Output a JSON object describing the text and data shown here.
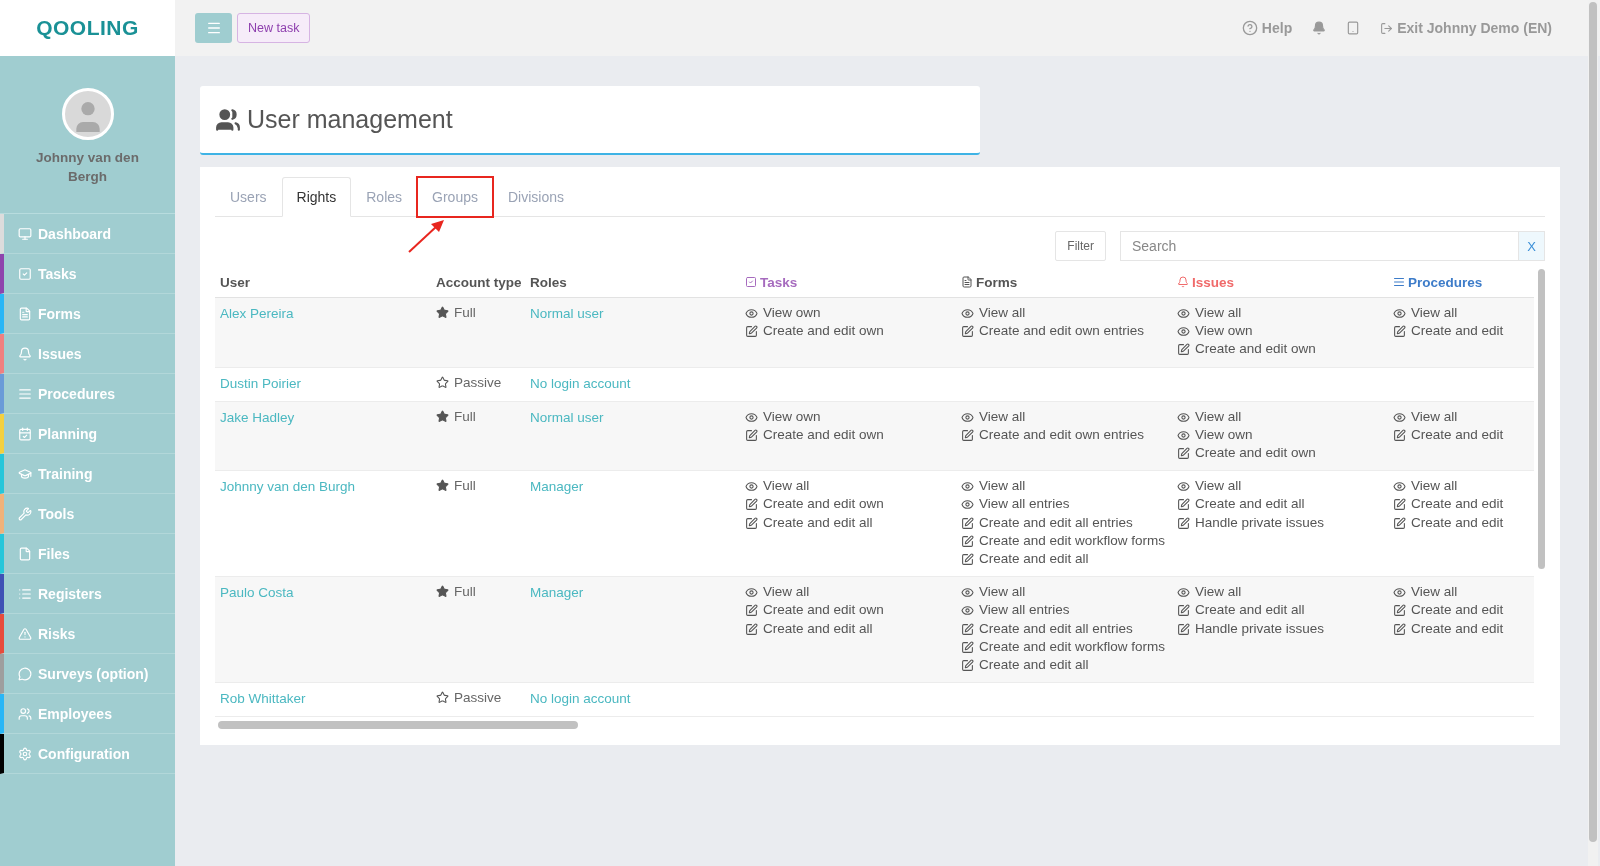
{
  "logo": "QOOLING",
  "topbar": {
    "new_task": "New task",
    "help": "Help",
    "exit": "Exit Johnny Demo (EN)"
  },
  "user": {
    "name": "Johnny van den Bergh"
  },
  "sidebar": {
    "items": [
      {
        "label": "Dashboard",
        "color": "#dcdcdc"
      },
      {
        "label": "Tasks",
        "color": "#8e44ad"
      },
      {
        "label": "Forms",
        "color": "#29b6f6"
      },
      {
        "label": "Issues",
        "color": "#f08080"
      },
      {
        "label": "Procedures",
        "color": "#6a9bd8"
      },
      {
        "label": "Planning",
        "color": "#f4d03f"
      },
      {
        "label": "Training",
        "color": "#26c6da"
      },
      {
        "label": "Tools",
        "color": "#f0b27a"
      },
      {
        "label": "Files",
        "color": "#26c6da"
      },
      {
        "label": "Registers",
        "color": "#3f51b5"
      },
      {
        "label": "Risks",
        "color": "#e74c3c"
      },
      {
        "label": "Surveys (option)",
        "color": "#9e9e9e"
      },
      {
        "label": "Employees",
        "color": "#29b6f6"
      },
      {
        "label": "Configuration",
        "color": "#000000"
      }
    ]
  },
  "page_title": "User management",
  "tabs": [
    {
      "label": "Users",
      "selected": false,
      "highlighted": false
    },
    {
      "label": "Rights",
      "selected": true,
      "highlighted": false
    },
    {
      "label": "Roles",
      "selected": false,
      "highlighted": false
    },
    {
      "label": "Groups",
      "selected": false,
      "highlighted": true
    },
    {
      "label": "Divisions",
      "selected": false,
      "highlighted": false
    }
  ],
  "filter_button": "Filter",
  "search": {
    "placeholder": "Search",
    "clear": "X"
  },
  "table": {
    "columns": [
      {
        "label": "User"
      },
      {
        "label": "Account type"
      },
      {
        "label": "Roles"
      },
      {
        "label": "Tasks",
        "color": "#a66bbe"
      },
      {
        "label": "Forms",
        "color": "#555555"
      },
      {
        "label": "Issues",
        "color": "#f06a6a"
      },
      {
        "label": "Procedures",
        "color": "#3d7cc9"
      }
    ],
    "rows": [
      {
        "user": "Alex Pereira",
        "account": {
          "kind": "full",
          "label": "Full"
        },
        "role": "Normal user",
        "tasks": [
          {
            "kind": "view",
            "label": "View own"
          },
          {
            "kind": "edit",
            "label": "Create and edit own"
          }
        ],
        "forms": [
          {
            "kind": "view",
            "label": "View all"
          },
          {
            "kind": "edit",
            "label": "Create and edit own entries"
          }
        ],
        "issues": [
          {
            "kind": "view",
            "label": "View all"
          },
          {
            "kind": "view",
            "label": "View own"
          },
          {
            "kind": "edit",
            "label": "Create and edit own"
          }
        ],
        "procedures": [
          {
            "kind": "view",
            "label": "View all"
          },
          {
            "kind": "edit",
            "label": "Create and edit"
          }
        ]
      },
      {
        "user": "Dustin Poirier",
        "account": {
          "kind": "passive",
          "label": "Passive"
        },
        "role": "No login account"
      },
      {
        "user": "Jake Hadley",
        "account": {
          "kind": "full",
          "label": "Full"
        },
        "role": "Normal user",
        "tasks": [
          {
            "kind": "view",
            "label": "View own"
          },
          {
            "kind": "edit",
            "label": "Create and edit own"
          }
        ],
        "forms": [
          {
            "kind": "view",
            "label": "View all"
          },
          {
            "kind": "edit",
            "label": "Create and edit own entries"
          }
        ],
        "issues": [
          {
            "kind": "view",
            "label": "View all"
          },
          {
            "kind": "view",
            "label": "View own"
          },
          {
            "kind": "edit",
            "label": "Create and edit own"
          }
        ],
        "procedures": [
          {
            "kind": "view",
            "label": "View all"
          },
          {
            "kind": "edit",
            "label": "Create and edit"
          }
        ]
      },
      {
        "user": "Johnny van den Burgh",
        "account": {
          "kind": "full",
          "label": "Full"
        },
        "role": "Manager",
        "tasks": [
          {
            "kind": "view",
            "label": "View all"
          },
          {
            "kind": "edit",
            "label": "Create and edit own"
          },
          {
            "kind": "edit",
            "label": "Create and edit all"
          }
        ],
        "forms": [
          {
            "kind": "view",
            "label": "View all"
          },
          {
            "kind": "view",
            "label": "View all entries"
          },
          {
            "kind": "edit",
            "label": "Create and edit all entries"
          },
          {
            "kind": "edit",
            "label": "Create and edit workflow forms"
          },
          {
            "kind": "edit",
            "label": "Create and edit all"
          }
        ],
        "issues": [
          {
            "kind": "view",
            "label": "View all"
          },
          {
            "kind": "edit",
            "label": "Create and edit all"
          },
          {
            "kind": "edit",
            "label": "Handle private issues"
          }
        ],
        "procedures": [
          {
            "kind": "view",
            "label": "View all"
          },
          {
            "kind": "edit",
            "label": "Create and edit"
          },
          {
            "kind": "edit",
            "label": "Create and edit"
          }
        ]
      },
      {
        "user": "Paulo Costa",
        "account": {
          "kind": "full",
          "label": "Full"
        },
        "role": "Manager",
        "tasks": [
          {
            "kind": "view",
            "label": "View all"
          },
          {
            "kind": "edit",
            "label": "Create and edit own"
          },
          {
            "kind": "edit",
            "label": "Create and edit all"
          }
        ],
        "forms": [
          {
            "kind": "view",
            "label": "View all"
          },
          {
            "kind": "view",
            "label": "View all entries"
          },
          {
            "kind": "edit",
            "label": "Create and edit all entries"
          },
          {
            "kind": "edit",
            "label": "Create and edit workflow forms"
          },
          {
            "kind": "edit",
            "label": "Create and edit all"
          }
        ],
        "issues": [
          {
            "kind": "view",
            "label": "View all"
          },
          {
            "kind": "edit",
            "label": "Create and edit all"
          },
          {
            "kind": "edit",
            "label": "Handle private issues"
          }
        ],
        "procedures": [
          {
            "kind": "view",
            "label": "View all"
          },
          {
            "kind": "edit",
            "label": "Create and edit"
          },
          {
            "kind": "edit",
            "label": "Create and edit"
          }
        ]
      },
      {
        "user": "Rob Whittaker",
        "account": {
          "kind": "passive",
          "label": "Passive"
        },
        "role": "No login account"
      }
    ]
  }
}
